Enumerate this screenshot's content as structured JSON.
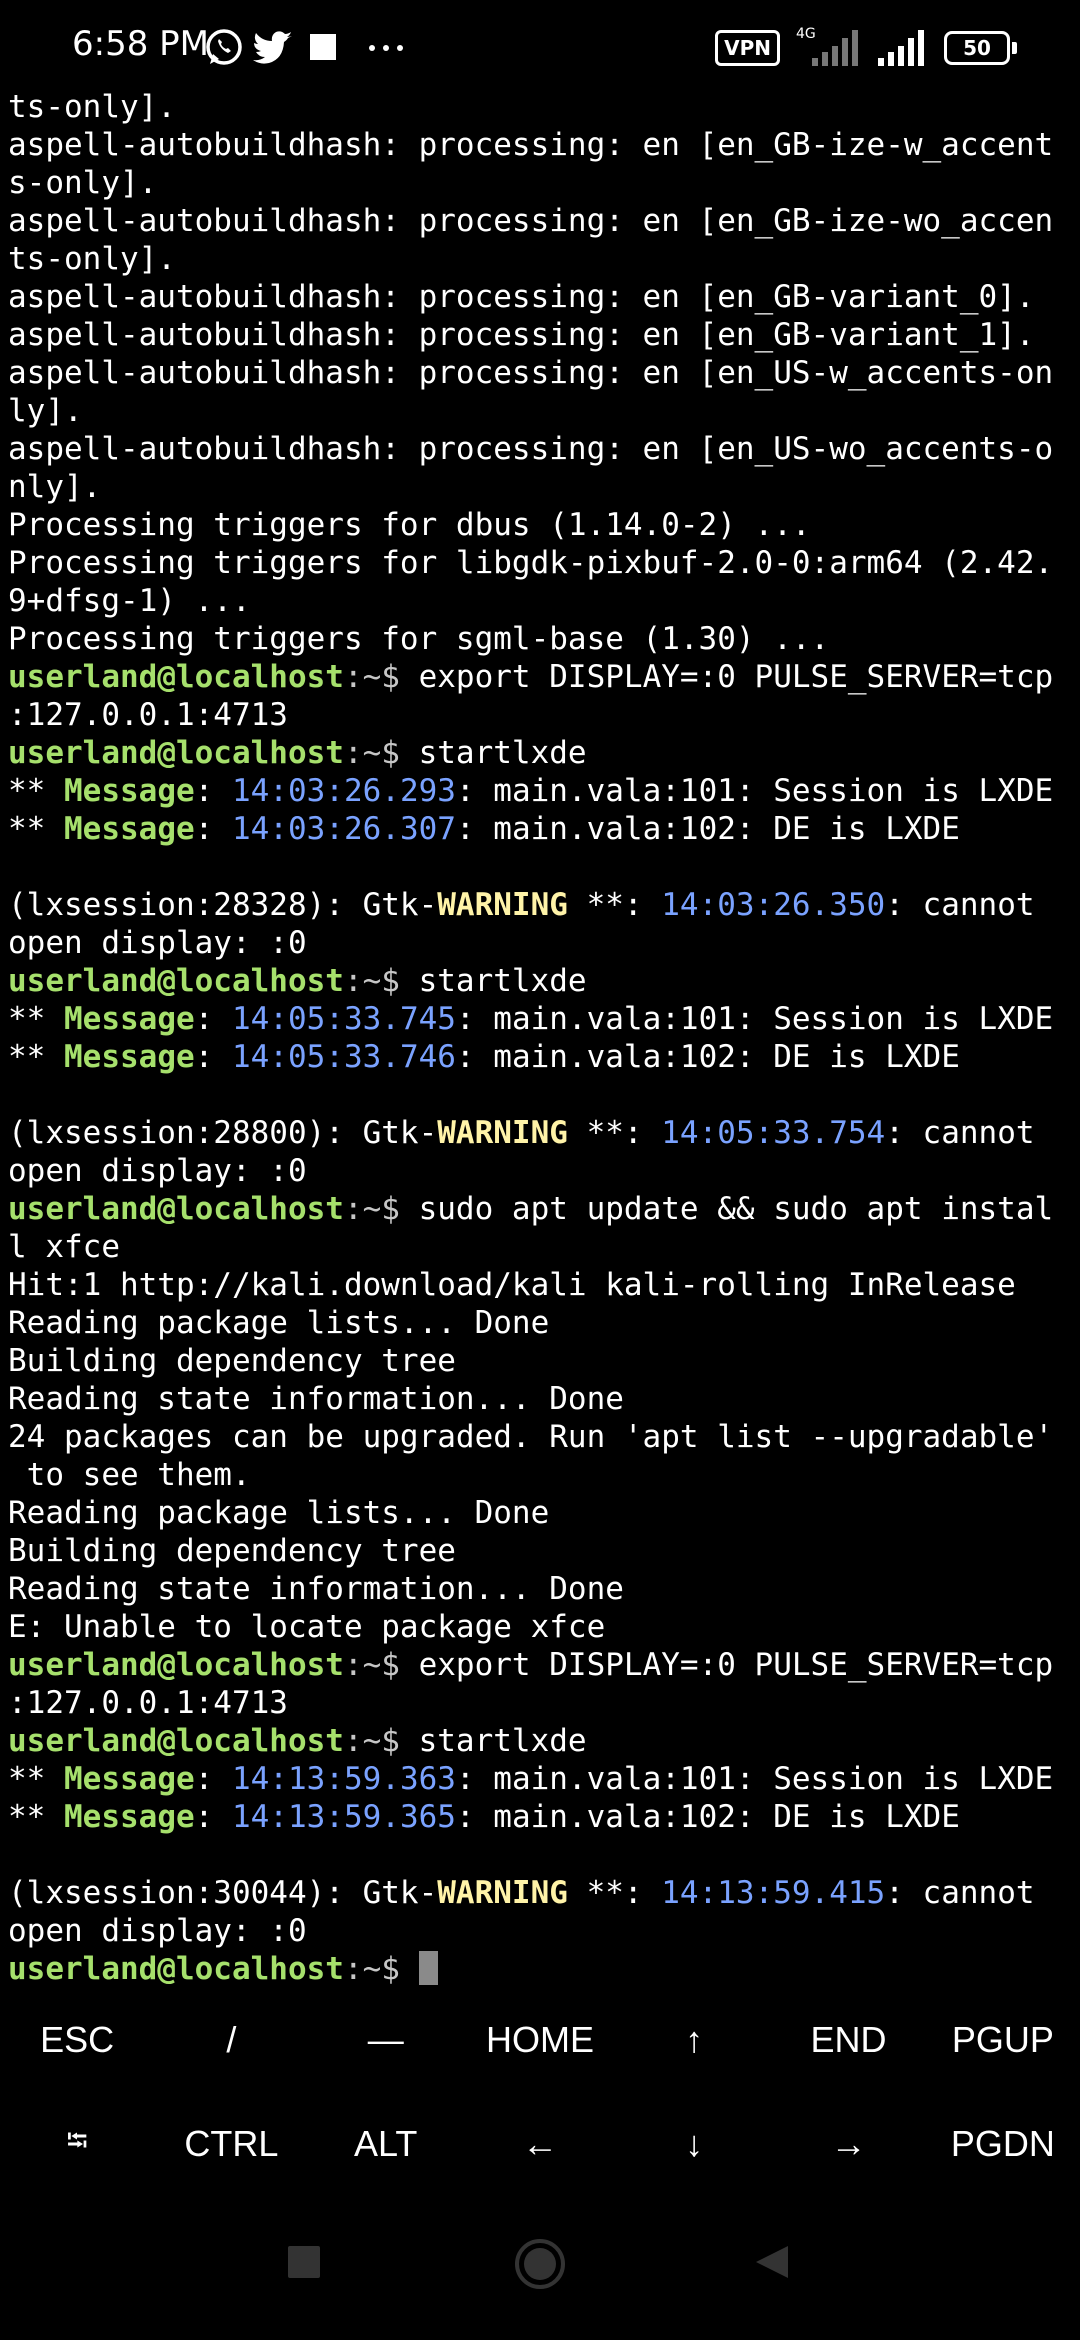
{
  "status_bar": {
    "time": "6:58 PM",
    "icons": [
      "whatsapp-icon",
      "twitter-icon",
      "square-icon",
      "more-icon"
    ],
    "vpn": "VPN",
    "network": "4G",
    "battery": "50"
  },
  "terminal": {
    "lines": [
      "ts-only].",
      "aspell-autobuildhash: processing: en [en_GB-ize-w_accent",
      "s-only].",
      "aspell-autobuildhash: processing: en [en_GB-ize-wo_accen",
      "ts-only].",
      "aspell-autobuildhash: processing: en [en_GB-variant_0].",
      "aspell-autobuildhash: processing: en [en_GB-variant_1].",
      "aspell-autobuildhash: processing: en [en_US-w_accents-on",
      "ly].",
      "aspell-autobuildhash: processing: en [en_US-wo_accents-o",
      "nly].",
      "Processing triggers for dbus (1.14.0-2) ...",
      "Processing triggers for libgdk-pixbuf-2.0-0:arm64 (2.42.",
      "9+dfsg-1) ...",
      "Processing triggers for sgml-base (1.30) ...",
      {
        "prompt": true,
        "user": "userland@localhost",
        "sep": ":~$ ",
        "cmd": "export DISPLAY=:0 PULSE_SERVER=tcp"
      },
      ":127.0.0.1:4713",
      {
        "prompt": true,
        "user": "userland@localhost",
        "sep": ":~$ ",
        "cmd": "startlxde"
      },
      {
        "msg": true,
        "stars": "** ",
        "label": "Message",
        "colon": ": ",
        "time": "14:03:26.293",
        "rest": ": main.vala:101: Session is LXDE"
      },
      {
        "msg": true,
        "stars": "** ",
        "label": "Message",
        "colon": ": ",
        "time": "14:03:26.307",
        "rest": ": main.vala:102: DE is LXDE"
      },
      "",
      {
        "warn": true,
        "pre": "(lxsession:28328): Gtk-",
        "label": "WARNING",
        "mid": " **: ",
        "time": "14:03:26.350",
        "rest": ": cannot"
      },
      "open display: :0",
      {
        "prompt": true,
        "user": "userland@localhost",
        "sep": ":~$ ",
        "cmd": "startlxde"
      },
      {
        "msg": true,
        "stars": "** ",
        "label": "Message",
        "colon": ": ",
        "time": "14:05:33.745",
        "rest": ": main.vala:101: Session is LXDE"
      },
      {
        "msg": true,
        "stars": "** ",
        "label": "Message",
        "colon": ": ",
        "time": "14:05:33.746",
        "rest": ": main.vala:102: DE is LXDE"
      },
      "",
      {
        "warn": true,
        "pre": "(lxsession:28800): Gtk-",
        "label": "WARNING",
        "mid": " **: ",
        "time": "14:05:33.754",
        "rest": ": cannot"
      },
      "open display: :0",
      {
        "prompt": true,
        "user": "userland@localhost",
        "sep": ":~$ ",
        "cmd": "sudo apt update && sudo apt instal"
      },
      "l xfce",
      "Hit:1 http://kali.download/kali kali-rolling InRelease",
      "Reading package lists... Done",
      "Building dependency tree",
      "Reading state information... Done",
      "24 packages can be upgraded. Run 'apt list --upgradable'",
      " to see them.",
      "Reading package lists... Done",
      "Building dependency tree",
      "Reading state information... Done",
      "E: Unable to locate package xfce",
      {
        "prompt": true,
        "user": "userland@localhost",
        "sep": ":~$ ",
        "cmd": "export DISPLAY=:0 PULSE_SERVER=tcp"
      },
      ":127.0.0.1:4713",
      {
        "prompt": true,
        "user": "userland@localhost",
        "sep": ":~$ ",
        "cmd": "startlxde"
      },
      {
        "msg": true,
        "stars": "** ",
        "label": "Message",
        "colon": ": ",
        "time": "14:13:59.363",
        "rest": ": main.vala:101: Session is LXDE"
      },
      {
        "msg": true,
        "stars": "** ",
        "label": "Message",
        "colon": ": ",
        "time": "14:13:59.365",
        "rest": ": main.vala:102: DE is LXDE"
      },
      "",
      {
        "warn": true,
        "pre": "(lxsession:30044): Gtk-",
        "label": "WARNING",
        "mid": " **: ",
        "time": "14:13:59.415",
        "rest": ": cannot"
      },
      "open display: :0",
      {
        "prompt": true,
        "user": "userland@localhost",
        "sep": ":~$ ",
        "cmd": "",
        "cursor": true
      }
    ]
  },
  "extra_keys": {
    "row1": [
      "ESC",
      "/",
      "—",
      "HOME",
      "↑",
      "END",
      "PGUP"
    ],
    "row2": [
      "⭾",
      "CTRL",
      "ALT",
      "←",
      "↓",
      "→",
      "PGDN"
    ]
  },
  "colors": {
    "background": "#000000",
    "prompt_user": "#a6e06c",
    "path": "#c6c6c6",
    "timestamp": "#7aa2ff",
    "warning": "#fff3a8",
    "cursor": "#8a8a8a"
  }
}
